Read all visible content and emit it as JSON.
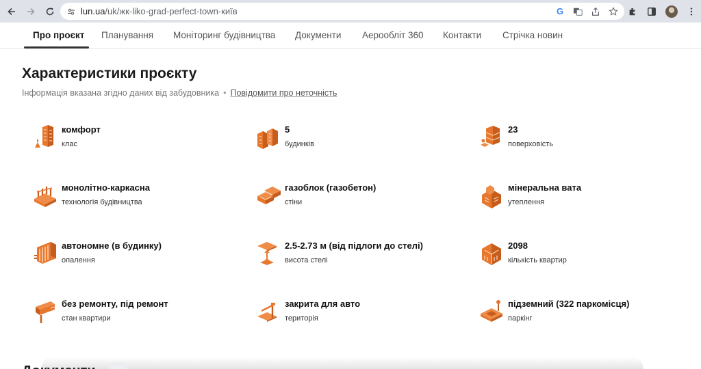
{
  "browser": {
    "url_host": "lun.ua",
    "url_path": "/uk/жк-liko-grad-perfect-town-київ"
  },
  "tabs": [
    {
      "label": "Про проєкт",
      "active": true
    },
    {
      "label": "Планування",
      "active": false
    },
    {
      "label": "Моніторинг будівництва",
      "active": false
    },
    {
      "label": "Документи",
      "active": false
    },
    {
      "label": "Аерообліт 360",
      "active": false
    },
    {
      "label": "Контакти",
      "active": false
    },
    {
      "label": "Стрічка новин",
      "active": false
    }
  ],
  "section": {
    "title": "Характеристики проєкту",
    "subtitle": "Інформація вказана згідно даних від забудовника",
    "separator": "•",
    "report_link": "Повідомити про неточність"
  },
  "characteristics": [
    {
      "value": "комфорт",
      "label": "клас",
      "icon": "building-class-icon"
    },
    {
      "value": "5",
      "label": "будинків",
      "icon": "houses-icon"
    },
    {
      "value": "23",
      "label": "поверховість",
      "icon": "floors-icon"
    },
    {
      "value": "монолітно-каркасна",
      "label": "технологія будівництва",
      "icon": "construction-tech-icon"
    },
    {
      "value": "газоблок (газобетон)",
      "label": "стіни",
      "icon": "walls-icon"
    },
    {
      "value": "мінеральна вата",
      "label": "утеплення",
      "icon": "insulation-icon"
    },
    {
      "value": "автономне (в будинку)",
      "label": "опалення",
      "icon": "heating-icon"
    },
    {
      "value": "2.5-2.73 м (від підлоги до стелі)",
      "label": "висота стелі",
      "icon": "ceiling-height-icon"
    },
    {
      "value": "2098",
      "label": "кількість квартир",
      "icon": "apartments-icon"
    },
    {
      "value": "без ремонту, під ремонт",
      "label": "стан квартири",
      "icon": "renovation-icon"
    },
    {
      "value": "закрита для авто",
      "label": "територія",
      "icon": "territory-icon"
    },
    {
      "value": "підземний (322 паркомісця)",
      "label": "паркінг",
      "icon": "parking-icon"
    }
  ],
  "next_section": {
    "title": "Документи"
  },
  "colors": {
    "accent": "#e8772e",
    "accent_dark": "#c75d1c",
    "text": "#1a1a1a",
    "muted": "#777777"
  }
}
